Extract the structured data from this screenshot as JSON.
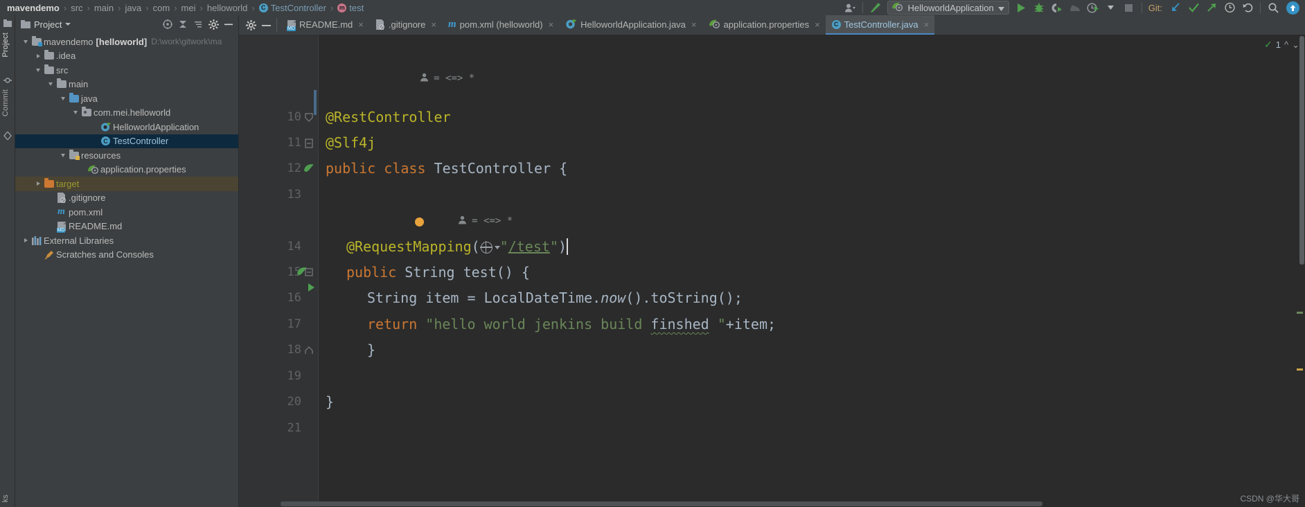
{
  "breadcrumb": {
    "items": [
      {
        "label": "mavendemo",
        "type": "root"
      },
      {
        "label": "src",
        "type": "dir"
      },
      {
        "label": "main",
        "type": "dir"
      },
      {
        "label": "java",
        "type": "dir"
      },
      {
        "label": "com",
        "type": "dir"
      },
      {
        "label": "mei",
        "type": "dir"
      },
      {
        "label": "helloworld",
        "type": "dir"
      },
      {
        "label": "TestController",
        "type": "class",
        "icon": "class-icon"
      },
      {
        "label": "test",
        "type": "method",
        "icon": "method-icon"
      }
    ],
    "separator": "›"
  },
  "toolbar": {
    "account_icon": "account-icon",
    "search_everywhere_icon": "search-icon",
    "run_config_name": "HelloworldApplication",
    "run_config_icon": "spring-boot-icon",
    "run_label": "Run",
    "debug_label": "Debug",
    "coverage_label": "Run with Coverage",
    "profile_label": "Profile",
    "stop_label": "Stop",
    "git_label": "Git:",
    "git_update_label": "Update Project",
    "git_commit_label": "Commit",
    "git_push_label": "Push",
    "git_history_label": "History",
    "git_rollback_label": "Rollback",
    "search_label": "Search Everywhere",
    "updates_badge": "updates-available-icon"
  },
  "left_strip": {
    "tabs": [
      {
        "label": "Project",
        "icon": "project-icon"
      },
      {
        "label": "Commit",
        "icon": "commit-icon"
      },
      {
        "label": "",
        "icon": "structure-icon"
      },
      {
        "label": "ks",
        "icon": "bookmarks-icon"
      }
    ]
  },
  "project_panel": {
    "title": "Project",
    "actions": [
      "target-icon",
      "collapse-icon",
      "expand-icon",
      "settings-icon",
      "hide-icon"
    ],
    "tree": [
      {
        "id": "root",
        "label": "mavendemo",
        "suffix": "[helloworld]",
        "path": "D:\\work\\gitwork\\ma",
        "indent": 0,
        "twisty": "down",
        "icon": "module-folder-icon",
        "state": "normal"
      },
      {
        "id": "idea",
        "label": ".idea",
        "indent": 1,
        "twisty": "right",
        "icon": "folder-icon",
        "state": "normal"
      },
      {
        "id": "src",
        "label": "src",
        "indent": 1,
        "twisty": "down",
        "icon": "folder-icon",
        "state": "normal"
      },
      {
        "id": "main",
        "label": "main",
        "indent": 2,
        "twisty": "down",
        "icon": "folder-icon",
        "state": "normal"
      },
      {
        "id": "java",
        "label": "java",
        "indent": 3,
        "twisty": "down",
        "icon": "source-folder-icon",
        "state": "normal"
      },
      {
        "id": "pkg",
        "label": "com.mei.helloworld",
        "indent": 4,
        "twisty": "down",
        "icon": "package-icon",
        "state": "normal"
      },
      {
        "id": "app",
        "label": "HelloworldApplication",
        "indent": 5,
        "twisty": "none",
        "icon": "spring-class-icon",
        "state": "normal"
      },
      {
        "id": "ctrl",
        "label": "TestController",
        "indent": 5,
        "twisty": "none",
        "icon": "class-icon",
        "state": "selected"
      },
      {
        "id": "res",
        "label": "resources",
        "indent": 3,
        "twisty": "down",
        "icon": "resource-folder-icon",
        "state": "normal"
      },
      {
        "id": "props",
        "label": "application.properties",
        "indent": 4,
        "twisty": "none",
        "icon": "spring-properties-icon",
        "state": "normal"
      },
      {
        "id": "target",
        "label": "target",
        "indent": 1,
        "twisty": "right",
        "icon": "excluded-folder-icon",
        "state": "excluded"
      },
      {
        "id": "gitignore",
        "label": ".gitignore",
        "indent": 2,
        "twisty": "none",
        "icon": "gitignore-icon",
        "state": "normal"
      },
      {
        "id": "pom",
        "label": "pom.xml",
        "indent": 2,
        "twisty": "none",
        "icon": "maven-icon",
        "state": "normal"
      },
      {
        "id": "readme",
        "label": "README.md",
        "indent": 2,
        "twisty": "none",
        "icon": "markdown-icon",
        "state": "normal"
      },
      {
        "id": "extlibs",
        "label": "External Libraries",
        "indent": 0,
        "twisty": "right",
        "icon": "libraries-icon",
        "state": "normal"
      },
      {
        "id": "scratches",
        "label": "Scratches and Consoles",
        "indent": 0,
        "twisty": "none",
        "icon": "scratches-icon",
        "state": "normal"
      }
    ]
  },
  "editor_tabs": {
    "left_actions": [
      "settings-icon",
      "minimize-icon"
    ],
    "tabs": [
      {
        "label": "README.md",
        "icon": "markdown-icon",
        "active": false,
        "close": "×"
      },
      {
        "label": ".gitignore",
        "icon": "gitignore-icon",
        "active": false,
        "close": "×"
      },
      {
        "label": "pom.xml (helloworld)",
        "icon": "maven-icon",
        "active": false,
        "close": "×"
      },
      {
        "label": "HelloworldApplication.java",
        "icon": "spring-class-icon",
        "active": false,
        "close": "×"
      },
      {
        "label": "application.properties",
        "icon": "spring-properties-icon",
        "active": false,
        "close": "×"
      },
      {
        "label": "TestController.java",
        "icon": "class-icon",
        "active": true,
        "close": "×"
      }
    ]
  },
  "inspection_widget": {
    "count": "1",
    "check_icon": "check-icon",
    "caret_icon": "chevron-down-icon"
  },
  "code": {
    "hint_top": {
      "icon": "user-icon",
      "text": "= <=> *"
    },
    "hint_mid": {
      "icon": "user-icon",
      "text": "= <=> *"
    },
    "lines": [
      {
        "num": "10",
        "indent": 0,
        "tokens": [
          {
            "t": "@RestController",
            "c": "ann"
          }
        ],
        "fold": "collapse-end",
        "gutter": null
      },
      {
        "num": "11",
        "indent": 0,
        "tokens": [
          {
            "t": "@Slf4j",
            "c": "ann"
          }
        ],
        "fold": "collapse-mid",
        "gutter": null
      },
      {
        "num": "12",
        "indent": 0,
        "tokens": [
          {
            "t": "public",
            "c": "kw"
          },
          {
            "t": " ",
            "c": "plain"
          },
          {
            "t": "class",
            "c": "kw"
          },
          {
            "t": " ",
            "c": "plain"
          },
          {
            "t": "TestController",
            "c": "cls"
          },
          {
            "t": " {",
            "c": "plain"
          }
        ],
        "fold": null,
        "gutter": "spring-bean-icon"
      },
      {
        "num": "13",
        "indent": 0,
        "tokens": [],
        "fold": null,
        "gutter": null
      },
      {
        "num": "14",
        "indent": 1,
        "tokens": [
          {
            "t": "@RequestMapping",
            "c": "ann"
          },
          {
            "t": "(",
            "c": "plain"
          },
          {
            "t": "GLOBE",
            "c": "globe"
          },
          {
            "t": "\"",
            "c": "str"
          },
          {
            "t": "/test",
            "c": "strlink"
          },
          {
            "t": "\"",
            "c": "str"
          },
          {
            "t": ")",
            "c": "plain"
          },
          {
            "t": "CARET",
            "c": "caret"
          }
        ],
        "fold": null,
        "gutter": "intention-bulb-icon"
      },
      {
        "num": "15",
        "indent": 1,
        "tokens": [
          {
            "t": "public",
            "c": "kw"
          },
          {
            "t": " ",
            "c": "plain"
          },
          {
            "t": "String",
            "c": "cls"
          },
          {
            "t": " test() {",
            "c": "plain"
          }
        ],
        "fold": "collapse-start",
        "gutter": "spring-endpoint-icon"
      },
      {
        "num": "16",
        "indent": 2,
        "tokens": [
          {
            "t": "String",
            "c": "cls"
          },
          {
            "t": " item = ",
            "c": "plain"
          },
          {
            "t": "LocalDateTime",
            "c": "cls"
          },
          {
            "t": ".",
            "c": "plain"
          },
          {
            "t": "now",
            "c": "ital"
          },
          {
            "t": "().toString();",
            "c": "plain"
          }
        ],
        "fold": null,
        "gutter": null
      },
      {
        "num": "17",
        "indent": 2,
        "tokens": [
          {
            "t": "return",
            "c": "kw"
          },
          {
            "t": " ",
            "c": "plain"
          },
          {
            "t": "\"hello world jenkins build ",
            "c": "str"
          },
          {
            "t": "finshed",
            "c": "typo-str"
          },
          {
            "t": " \"",
            "c": "str"
          },
          {
            "t": "+item;",
            "c": "plain"
          }
        ],
        "fold": null,
        "gutter": null
      },
      {
        "num": "18",
        "indent": 1,
        "tokens": [
          {
            "t": "}",
            "c": "plain"
          }
        ],
        "fold": "collapse-end2",
        "gutter": null
      },
      {
        "num": "19",
        "indent": 0,
        "tokens": [],
        "fold": null,
        "gutter": null
      },
      {
        "num": "20",
        "indent": 0,
        "tokens": [
          {
            "t": "}",
            "c": "plain"
          }
        ],
        "fold": null,
        "gutter": null
      },
      {
        "num": "21",
        "indent": 0,
        "tokens": [],
        "fold": null,
        "gutter": null
      }
    ]
  },
  "watermark": "CSDN @华大哥",
  "colors": {
    "bg_panel": "#3c3f41",
    "bg_editor": "#2b2b2b",
    "bg_gutter": "#313335",
    "selection": "#0d293e",
    "excluded": "#4b4433",
    "annotation": "#bbb529",
    "keyword": "#cc7832",
    "string": "#6a8759",
    "identifier": "#a9b7c6",
    "accent_blue": "#3592c4",
    "git_label": "#c5a06a"
  }
}
